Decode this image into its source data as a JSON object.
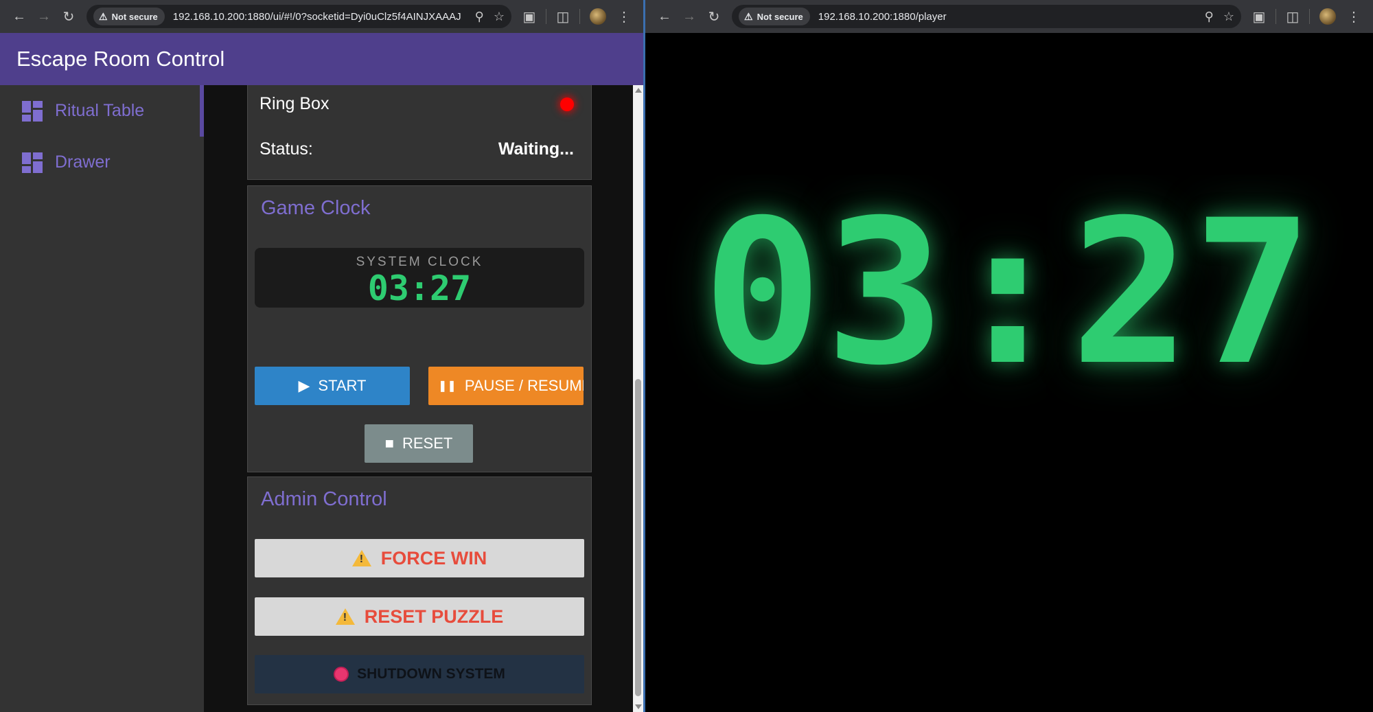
{
  "left_browser": {
    "security_label": "Not secure",
    "url": "192.168.10.200:1880/ui/#!/0?socketid=Dyi0uClz5f4AINJXAAAJ"
  },
  "right_browser": {
    "security_label": "Not secure",
    "url": "192.168.10.200:1880/player"
  },
  "app": {
    "title": "Escape Room Control"
  },
  "sidebar": {
    "items": [
      {
        "label": "Ritual Table",
        "icon": "dashboard-icon",
        "active": true
      },
      {
        "label": "Drawer",
        "icon": "dashboard-icon",
        "active": false
      }
    ]
  },
  "ring_box": {
    "title": "Ring Box",
    "indicator_color": "#ff0000",
    "status_label": "Status:",
    "status_value": "Waiting..."
  },
  "game_clock": {
    "title": "Game Clock",
    "clock_label": "SYSTEM CLOCK",
    "time": "03:27",
    "start_label": "START",
    "pause_label": "PAUSE / RESUME",
    "reset_label": "RESET"
  },
  "admin": {
    "title": "Admin Control",
    "force_win_label": "FORCE WIN",
    "reset_puzzle_label": "RESET PUZZLE",
    "shutdown_label": "SHUTDOWN SYSTEM"
  },
  "player": {
    "time": "03:27"
  },
  "colors": {
    "header": "#4f3f8c",
    "accent": "#7f6ed0",
    "clock_green": "#2ecc71",
    "start": "#2e84c8",
    "pause": "#ee8825",
    "reset": "#7c8c8c",
    "danger_text": "#e74c3c"
  }
}
